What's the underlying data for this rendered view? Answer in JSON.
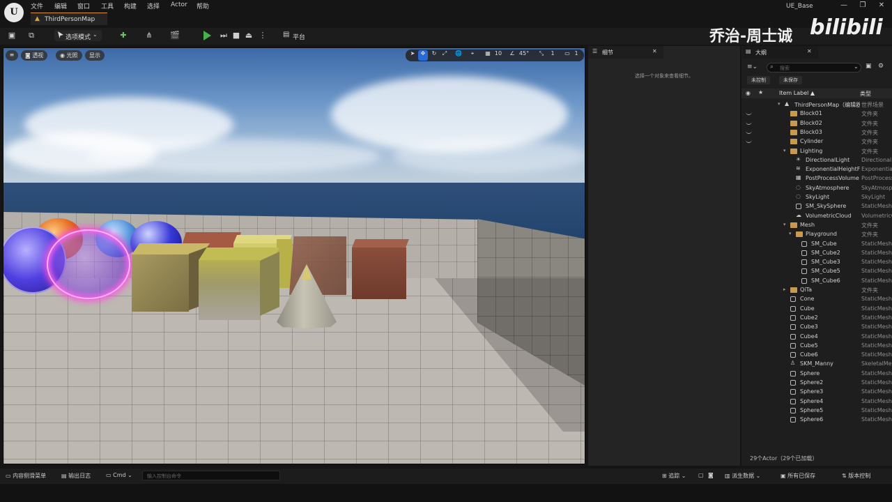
{
  "window": {
    "app_logo": "U",
    "project_name": "UE_Base",
    "controls": [
      "—",
      "❐",
      "✕"
    ]
  },
  "menu": [
    "文件",
    "编辑",
    "窗口",
    "工具",
    "构建",
    "选择",
    "Actor",
    "帮助"
  ],
  "level_tab": {
    "label": "ThirdPersonMap"
  },
  "toolbar": {
    "mode_label": "选项模式",
    "platform_label": "平台"
  },
  "watermark": {
    "text": "乔治-周士诚",
    "logo": "bilibili"
  },
  "viewport": {
    "menu_icon": "≡",
    "perspective_label": "透视",
    "lighting_label": "光照",
    "show_label": "显示",
    "grid_snap_value": "10",
    "rotation_snap_value": "45°",
    "scale_snap_value": "1",
    "camera_speed_value": "1"
  },
  "details": {
    "tab_label": "细节",
    "empty_message": "选择一个对象来查看细节。"
  },
  "outliner": {
    "tab_label": "大纲",
    "search_placeholder": "搜索",
    "chip_unsaved": "未控制",
    "chip_unsaved2": "未保存",
    "col_label": "Item Label ▲",
    "col_type": "类型",
    "rows": [
      {
        "name": "ThirdPersonMap（编辑器）",
        "type": "世界场景",
        "indent": 0,
        "icon": "map",
        "expanded": true,
        "eye": false
      },
      {
        "name": "Block01",
        "type": "文件夹",
        "indent": 1,
        "icon": "folder",
        "eye": true
      },
      {
        "name": "Block02",
        "type": "文件夹",
        "indent": 1,
        "icon": "folder",
        "eye": true
      },
      {
        "name": "Block03",
        "type": "文件夹",
        "indent": 1,
        "icon": "folder",
        "eye": true
      },
      {
        "name": "Cylinder",
        "type": "文件夹",
        "indent": 1,
        "icon": "folder",
        "eye": true
      },
      {
        "name": "Lighting",
        "type": "文件夹",
        "indent": 1,
        "icon": "folder",
        "expanded": true
      },
      {
        "name": "DirectionalLight",
        "type": "DirectionalLight",
        "indent": 2,
        "icon": "light"
      },
      {
        "name": "ExponentialHeightFog",
        "type": "ExponentialHeightFog",
        "indent": 2,
        "icon": "fog"
      },
      {
        "name": "PostProcessVolume",
        "type": "PostProcessVolume",
        "indent": 2,
        "icon": "volume"
      },
      {
        "name": "SkyAtmosphere",
        "type": "SkyAtmosphere",
        "indent": 2,
        "icon": "sky"
      },
      {
        "name": "SkyLight",
        "type": "SkyLight",
        "indent": 2,
        "icon": "sky"
      },
      {
        "name": "SM_SkySphere",
        "type": "StaticMeshActor",
        "indent": 2,
        "icon": "mesh"
      },
      {
        "name": "VolumetricCloud",
        "type": "VolumetricCloud",
        "indent": 2,
        "icon": "cloud"
      },
      {
        "name": "Mesh",
        "type": "文件夹",
        "indent": 1,
        "icon": "folder",
        "expanded": true
      },
      {
        "name": "Playground",
        "type": "文件夹",
        "indent": 2,
        "icon": "folder",
        "expanded": true
      },
      {
        "name": "SM_Cube",
        "type": "StaticMeshActor",
        "indent": 3,
        "icon": "mesh"
      },
      {
        "name": "SM_Cube2",
        "type": "StaticMeshActor",
        "indent": 3,
        "icon": "mesh"
      },
      {
        "name": "SM_Cube3",
        "type": "StaticMeshActor",
        "indent": 3,
        "icon": "mesh"
      },
      {
        "name": "SM_Cube5",
        "type": "StaticMeshActor",
        "indent": 3,
        "icon": "mesh"
      },
      {
        "name": "SM_Cube6",
        "type": "StaticMeshActor",
        "indent": 3,
        "icon": "mesh"
      },
      {
        "name": "QiTa",
        "type": "文件夹",
        "indent": 1,
        "icon": "folder",
        "collapsed": true
      },
      {
        "name": "Cone",
        "type": "StaticMeshActor",
        "indent": 1,
        "icon": "mesh"
      },
      {
        "name": "Cube",
        "type": "StaticMeshActor",
        "indent": 1,
        "icon": "mesh"
      },
      {
        "name": "Cube2",
        "type": "StaticMeshActor",
        "indent": 1,
        "icon": "mesh"
      },
      {
        "name": "Cube3",
        "type": "StaticMeshActor",
        "indent": 1,
        "icon": "mesh"
      },
      {
        "name": "Cube4",
        "type": "StaticMeshActor",
        "indent": 1,
        "icon": "mesh"
      },
      {
        "name": "Cube5",
        "type": "StaticMeshActor",
        "indent": 1,
        "icon": "mesh"
      },
      {
        "name": "Cube6",
        "type": "StaticMeshActor",
        "indent": 1,
        "icon": "mesh"
      },
      {
        "name": "SKM_Manny",
        "type": "SkeletalMeshActor",
        "indent": 1,
        "icon": "skeletal"
      },
      {
        "name": "Sphere",
        "type": "StaticMeshActor",
        "indent": 1,
        "icon": "mesh"
      },
      {
        "name": "Sphere2",
        "type": "StaticMeshActor",
        "indent": 1,
        "icon": "mesh"
      },
      {
        "name": "Sphere3",
        "type": "StaticMeshActor",
        "indent": 1,
        "icon": "mesh"
      },
      {
        "name": "Sphere4",
        "type": "StaticMeshActor",
        "indent": 1,
        "icon": "mesh"
      },
      {
        "name": "Sphere5",
        "type": "StaticMeshActor",
        "indent": 1,
        "icon": "mesh"
      },
      {
        "name": "Sphere6",
        "type": "StaticMeshActor",
        "indent": 1,
        "icon": "mesh"
      }
    ],
    "footer": "29个Actor（29个已加载）"
  },
  "bottombar": {
    "content_drawer": "内容侧滑菜单",
    "output_log": "输出日志",
    "cmd_label": "Cmd",
    "cmd_placeholder": "输入控制台命令",
    "trace": "追踪",
    "derived_data": "派生数据",
    "save_all": "所有已保存",
    "source_control": "版本控制"
  },
  "colors": {
    "accent_orange": "#e09030",
    "play_green": "#46b24a",
    "folder": "#c89a50",
    "panel_bg": "#242424"
  }
}
